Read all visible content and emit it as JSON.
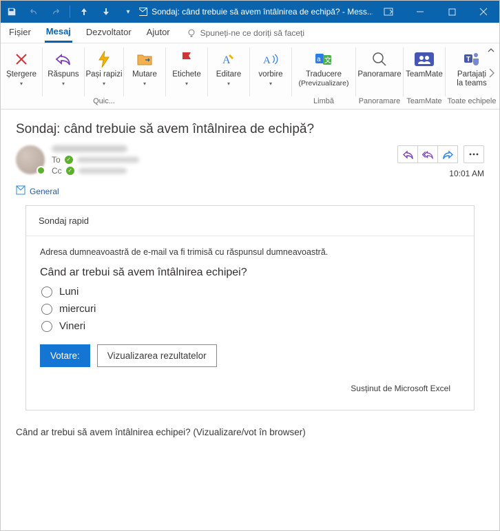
{
  "window": {
    "title": "Sondaj: când trebuie să avem întâlnirea de echipă? - Mess..."
  },
  "tabs": {
    "file": "Fișier",
    "message": "Mesaj",
    "developer": "Dezvoltator",
    "help": "Ajutor",
    "tell_me": "Spuneți-ne ce doriți să faceți"
  },
  "ribbon": {
    "delete": "Ștergere",
    "respond": "Răspuns",
    "quick_steps": "Pași rapizi",
    "quick_steps_group": "Quic...",
    "move": "Mutare",
    "tags": "Etichete",
    "editing": "Editare",
    "speech": "vorbire",
    "translate": "Traducere",
    "translate_sub": "(Previzualizare)",
    "translate_group": "Limbă",
    "zoom": "Panoramare",
    "zoom_group": "Panoramare",
    "teammate": "TeamMate",
    "teammate_group": "TeamMate",
    "share_teams": "Partajați la teams",
    "share_teams_group": "Toate echipele"
  },
  "message": {
    "subject": "Sondaj: când trebuie să avem întâlnirea de echipă?",
    "to_label": "To",
    "cc_label": "Cc",
    "time": "10:01 AM",
    "category": "General"
  },
  "poll": {
    "header": "Sondaj rapid",
    "note": "Adresa dumneavoastră de e-mail va fi trimisă cu răspunsul dumneavoastră.",
    "question": "Când ar trebui să avem întâlnirea echipei?",
    "options": [
      "Luni",
      "miercuri",
      "Vineri"
    ],
    "vote": "Votare:",
    "view_results": "Vizualizarea rezultatelor",
    "powered_by": "Susținut de Microsoft Excel"
  },
  "footer": {
    "browser_link": "Când ar trebui să avem întâlnirea echipei? (Vizualizare/vot în browser)"
  }
}
